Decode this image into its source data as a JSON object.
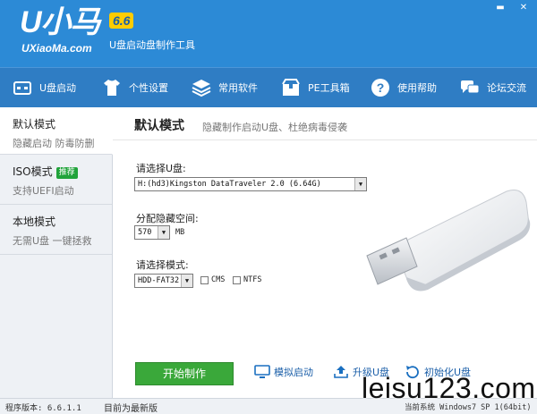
{
  "header": {
    "logo_main": "U小马",
    "logo_version": "6.6",
    "logo_url": "UXiaoMa.com",
    "subtitle": "U盘启动盘制作工具",
    "brand_color": "#2c8ad6"
  },
  "toolbar": {
    "items": [
      {
        "label": "U盘启动",
        "icon": "usb-drive-icon"
      },
      {
        "label": "个性设置",
        "icon": "tshirt-icon"
      },
      {
        "label": "常用软件",
        "icon": "layers-icon"
      },
      {
        "label": "PE工具箱",
        "icon": "box-icon"
      },
      {
        "label": "使用帮助",
        "icon": "question-icon"
      },
      {
        "label": "论坛交流",
        "icon": "chat-icon"
      }
    ]
  },
  "sidebar": {
    "items": [
      {
        "title": "默认模式",
        "sub": "隐藏启动 防毒防删"
      },
      {
        "title": "ISO模式",
        "badge": "推荐",
        "sub": "支持UEFI启动"
      },
      {
        "title": "本地模式",
        "sub": "无需U盘 一键拯救"
      }
    ]
  },
  "main": {
    "title": "默认模式",
    "description": "隐藏制作启动U盘、杜绝病毒侵袭",
    "select_disk_label": "请选择U盘:",
    "select_disk_value": "H:(hd3)Kingston DataTraveler 2.0 (6.64G)",
    "hidden_space_label": "分配隐藏空间:",
    "hidden_space_value": "570",
    "hidden_space_unit": "MB",
    "mode_label": "请选择模式:",
    "mode_value": "HDD-FAT32",
    "chk_cms": "CMS",
    "chk_ntfs": "NTFS",
    "start_button": "开始制作",
    "action_simulate": "模拟启动",
    "action_upgrade": "升级U盘",
    "action_restore": "初始化U盘"
  },
  "status": {
    "version": "程序版本: 6.6.1.1",
    "latest": "目前为最新版",
    "system": "当前系统 Windows7 SP 1(64bit)"
  },
  "watermark": "leisu123.com"
}
